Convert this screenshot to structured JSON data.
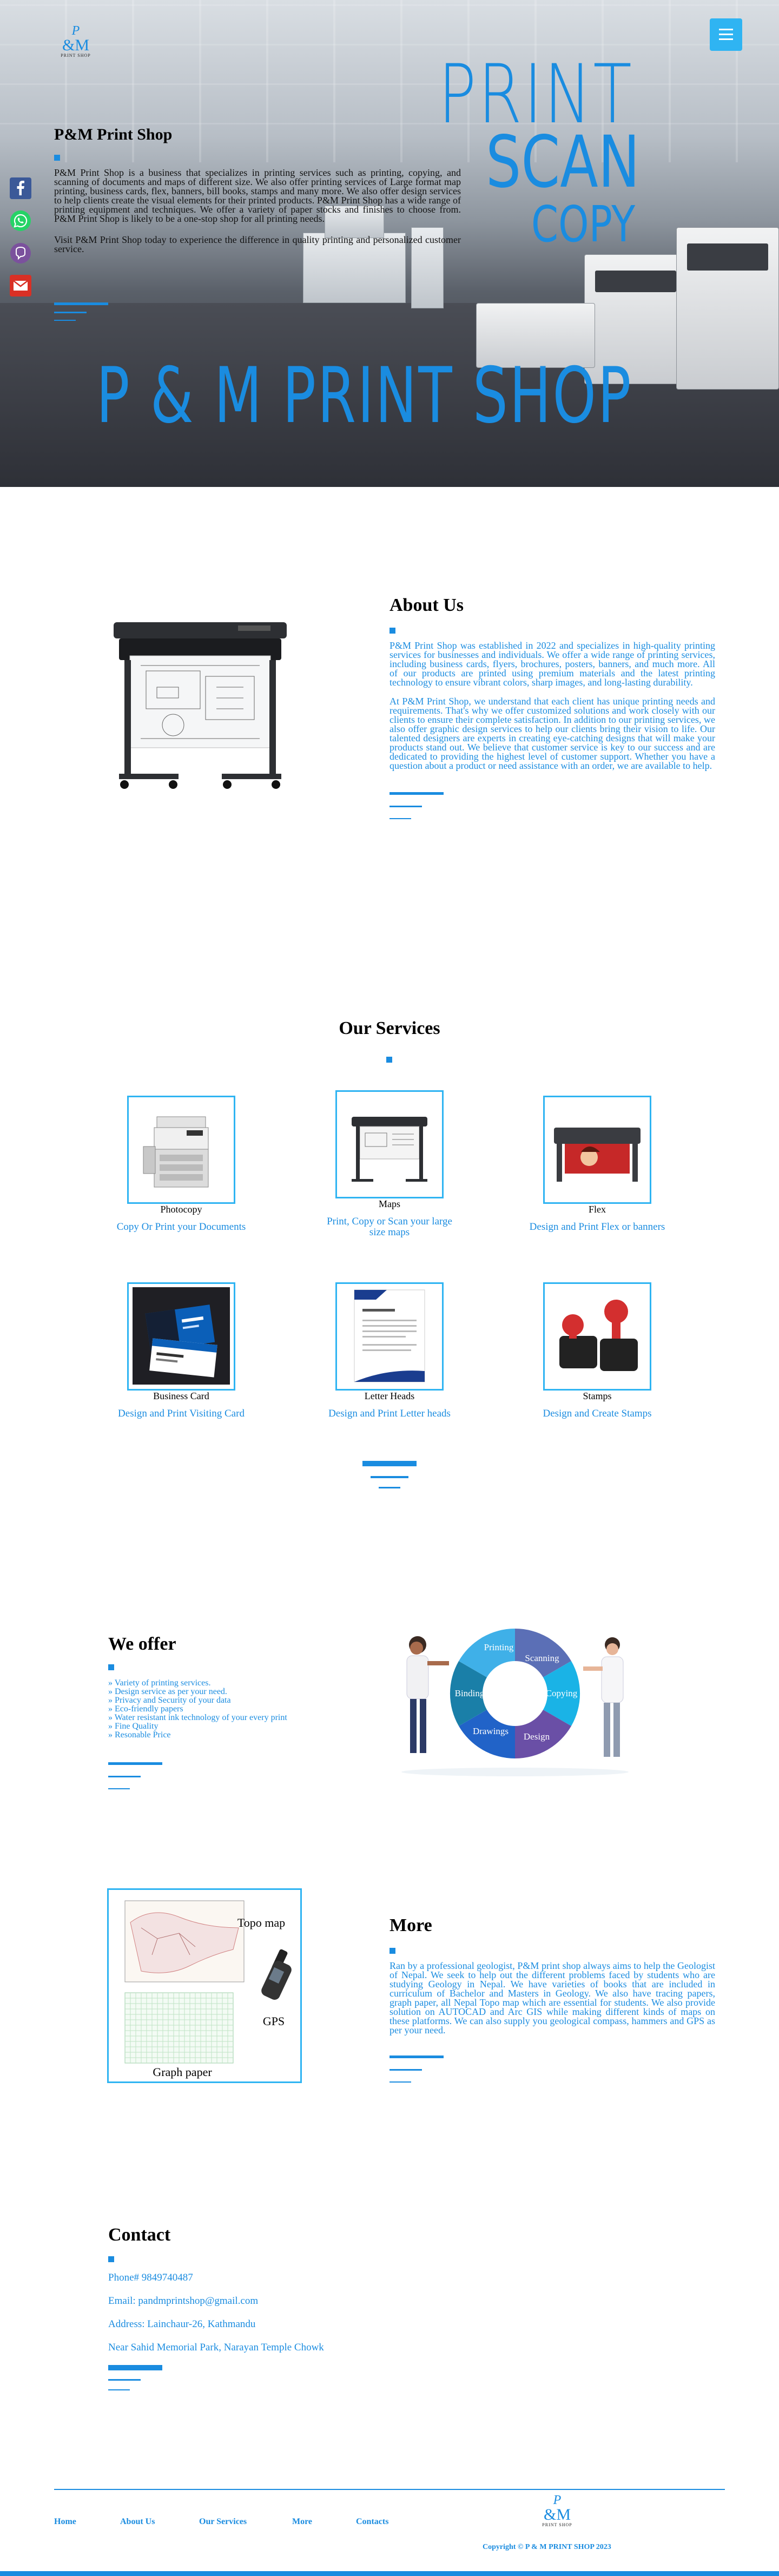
{
  "brand": {
    "logo_top": "P",
    "logo_amp": "&M",
    "logo_sub": "PRINT SHOP",
    "accent_color": "#1a8ce0",
    "highlight_color": "#2fb4f2"
  },
  "nav": {
    "menu_icon": "hamburger-icon"
  },
  "hero": {
    "title": "P&M Print Shop",
    "description": "P&M Print Shop is a business that specializes in printing services such as printing, copying, and scanning of documents and maps of different size. We also offer printing services of Large format map printing, business cards, flex, banners, bill books, stamps and many more. We also offer design services to help clients create the visual elements for their printed products. P&M Print Shop has a wide range of printing equipment and techniques. We offer a variety of paper stocks and finishes to choose from. P&M Print Shop is likely to be a one-stop shop for all printing needs.",
    "description2": "Visit P&M Print Shop today to experience the difference in quality printing and personalized customer service.",
    "overlay_print": "PRINT",
    "overlay_scan": "SCAN",
    "overlay_copy": "COPY",
    "overlay_shop": "P & M PRINT SHOP"
  },
  "social": {
    "icons": [
      "facebook-icon",
      "whatsapp-icon",
      "viber-icon",
      "gmail-icon"
    ]
  },
  "about": {
    "title": "About Us",
    "para1": "P&M Print Shop was established in 2022 and specializes in high-quality printing services for businesses and individuals. We offer a wide range of printing services, including business cards, flyers, brochures, posters, banners, and much more. All of our products are printed using premium materials and the latest printing technology to ensure vibrant colors, sharp images, and long-lasting durability.",
    "para2": "At P&M Print Shop, we understand that each client has unique printing needs and requirements. That's why we offer customized solutions and work closely with our clients to ensure their complete satisfaction. In addition to our printing services, we also offer graphic design services to help our clients bring their vision to life. Our talented designers are experts in creating eye-catching designs that will make your products stand out. We believe that customer service is key to our success and are dedicated to providing the highest level of customer support. Whether you have a question about a product or need assistance with an order, we are available to help."
  },
  "services": {
    "title": "Our Services",
    "items": [
      {
        "name": "Photocopy",
        "desc": "Copy Or Print your Documents"
      },
      {
        "name": "Maps",
        "desc": "Print, Copy or Scan your large size maps"
      },
      {
        "name": "Flex",
        "desc": "Design and Print Flex or banners"
      },
      {
        "name": "Business Card",
        "desc": "Design and Print Visiting Card"
      },
      {
        "name": "Letter Heads",
        "desc": "Design and Print Letter heads"
      },
      {
        "name": "Stamps",
        "desc": "Design and Create Stamps"
      }
    ]
  },
  "offer": {
    "title": "We offer",
    "items": [
      "Variety of printing services.",
      "Design service as per your need.",
      "Privacy and Security of your data",
      "Eco-friendly papers",
      "Water resistant ink technology of your every print",
      "Fine Quality",
      "Resonable Price"
    ],
    "cycle": [
      "Printing",
      "Scanning",
      "Copying",
      "Design",
      "Drawings",
      "Binding"
    ]
  },
  "more": {
    "title": "More",
    "label_topo": "Topo map",
    "label_gps": "GPS",
    "label_graph": "Graph paper",
    "para": "Ran by a professional geologist, P&M print shop always aims to help the Geologist of Nepal. We seek to help out the different problems faced by students who are studying Geology in Nepal. We have varieties of books that are included in curriculum of Bachelor and Masters in Geology. We also have tracing papers, graph paper, all Nepal Topo map which are essential for students. We also provide solution on AUTOCAD and Arc GIS while making different kinds of maps on these platforms. We can also supply you geological compass, hammers and GPS as per your need."
  },
  "contact": {
    "title": "Contact",
    "phone": "Phone# 9849740487",
    "email": "Email: pandmprintshop@gmail.com",
    "address": "Address: Lainchaur-26, Kathmandu",
    "near": "Near Sahid Memorial Park, Narayan Temple Chowk"
  },
  "footer": {
    "links": [
      "Home",
      "About Us",
      "Our Services",
      "More",
      "Contacts"
    ],
    "copyright": "Copyright © P & M PRINT SHOP 2023"
  }
}
